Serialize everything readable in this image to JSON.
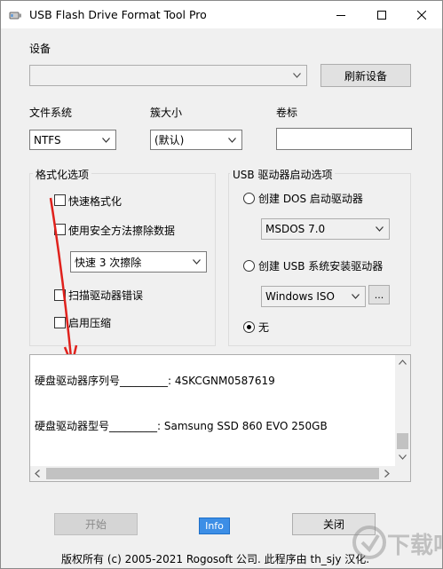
{
  "window": {
    "title": "USB Flash Drive Format Tool Pro"
  },
  "device": {
    "label": "设备",
    "selected_value": "",
    "refresh_button": "刷新设备"
  },
  "file_system": {
    "label": "文件系统",
    "value": "NTFS"
  },
  "cluster_size": {
    "label": "簇大小",
    "value": "(默认)"
  },
  "volume_label": {
    "label": "卷标",
    "value": ""
  },
  "format_options": {
    "title": "格式化选项",
    "quick_format": "快速格式化",
    "secure_erase": "使用安全方法擦除数据",
    "erase_method": "快速 3 次擦除",
    "scan_errors": "扫描驱动器错误",
    "enable_compression": "启用压缩"
  },
  "boot_options": {
    "title": "USB 驱动器启动选项",
    "create_dos": "创建 DOS 启动驱动器",
    "dos_version": "MSDOS 7.0",
    "create_usb_installer": "创建 USB 系统安装驱动器",
    "installer_source": "Windows ISO",
    "browse_label": "...",
    "none": "无"
  },
  "info_panel": {
    "serial_line": "硬盘驱动器序列号_________: 4SKCGNM0587619",
    "model_line": "硬盘驱动器型号_________: Samsung SSD 860 EVO 250GB"
  },
  "footer": {
    "start_button": "开始",
    "info_button": "Info",
    "close_button": "关闭",
    "copyright": "版权所有 (c) 2005-2021 Rogosoft 公司.  此程序由 th_sjy 汉化."
  },
  "watermark": {
    "text": "下载吧"
  }
}
